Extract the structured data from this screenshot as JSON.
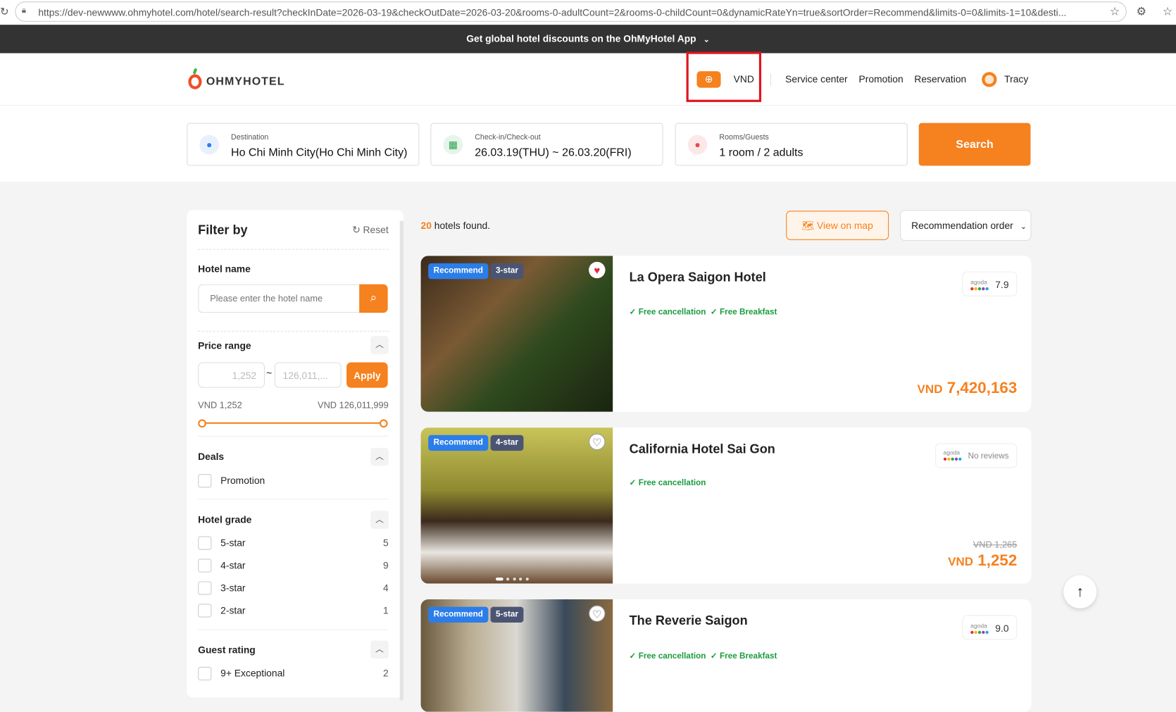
{
  "browser": {
    "url": "https://dev-newwww.ohmyhotel.com/hotel/search-result?checkInDate=2026-03-19&checkOutDate=2026-03-20&rooms-0-adultCount=2&rooms-0-childCount=0&dynamicRateYn=true&sortOrder=Recommend&limits-0=0&limits-1=10&desti..."
  },
  "banner": {
    "text": "Get global hotel discounts on the OhMyHotel App"
  },
  "header": {
    "logo": "OHMYHOTEL",
    "currency": "VND",
    "nav": [
      "Service center",
      "Promotion",
      "Reservation"
    ],
    "user": "Tracy"
  },
  "search": {
    "destination": {
      "label": "Destination",
      "value": "Ho Chi Minh City(Ho Chi Minh City)"
    },
    "dates": {
      "label": "Check-in/Check-out",
      "value": "26.03.19(THU) ~ 26.03.20(FRI)"
    },
    "rooms": {
      "label": "Rooms/Guests",
      "value": "1 room / 2 adults"
    },
    "button": "Search"
  },
  "filter": {
    "title": "Filter by",
    "reset": "Reset",
    "hotel_name_label": "Hotel name",
    "hotel_name_placeholder": "Please enter the hotel name",
    "price_label": "Price range",
    "price_min": "1,252",
    "price_max": "126,011,...",
    "apply": "Apply",
    "range_min": "VND 1,252",
    "range_max": "VND 126,011,999",
    "range_fill": [
      0,
      1
    ],
    "deals_label": "Deals",
    "deals": [
      {
        "label": "Promotion"
      }
    ],
    "grade_label": "Hotel grade",
    "grades": [
      {
        "label": "5-star",
        "count": "5"
      },
      {
        "label": "4-star",
        "count": "9"
      },
      {
        "label": "3-star",
        "count": "4"
      },
      {
        "label": "2-star",
        "count": "1"
      }
    ],
    "rating_label": "Guest rating",
    "ratings": [
      {
        "label": "9+ Exceptional",
        "count": "2"
      }
    ]
  },
  "results": {
    "count": "20",
    "count_suffix": " hotels found.",
    "map_button": "View on map",
    "sort": "Recommendation order",
    "hotels": [
      {
        "name": "La Opera Saigon Hotel",
        "badge": "Recommend",
        "star": "3-star",
        "features": [
          "Free cancellation",
          "Free Breakfast"
        ],
        "review_source": "agoda",
        "rating": "7.9",
        "currency": "VND",
        "price": "7,420,163",
        "liked": true
      },
      {
        "name": "California Hotel Sai Gon",
        "badge": "Recommend",
        "star": "4-star",
        "features": [
          "Free cancellation"
        ],
        "review_source": "agoda",
        "rating": "No reviews",
        "original_price": "VND 1,265",
        "currency": "VND",
        "price": "1,252",
        "liked": false
      },
      {
        "name": "The Reverie Saigon",
        "badge": "Recommend",
        "star": "5-star",
        "features": [
          "Free cancellation",
          "Free Breakfast"
        ],
        "review_source": "agoda",
        "rating": "9.0",
        "liked": false
      }
    ]
  },
  "colors": {
    "accent": "#f5811f",
    "recommend": "#2b7de9",
    "star": "#4b5573",
    "feature": "#1a9c3e",
    "highlight": "#e0141e"
  }
}
